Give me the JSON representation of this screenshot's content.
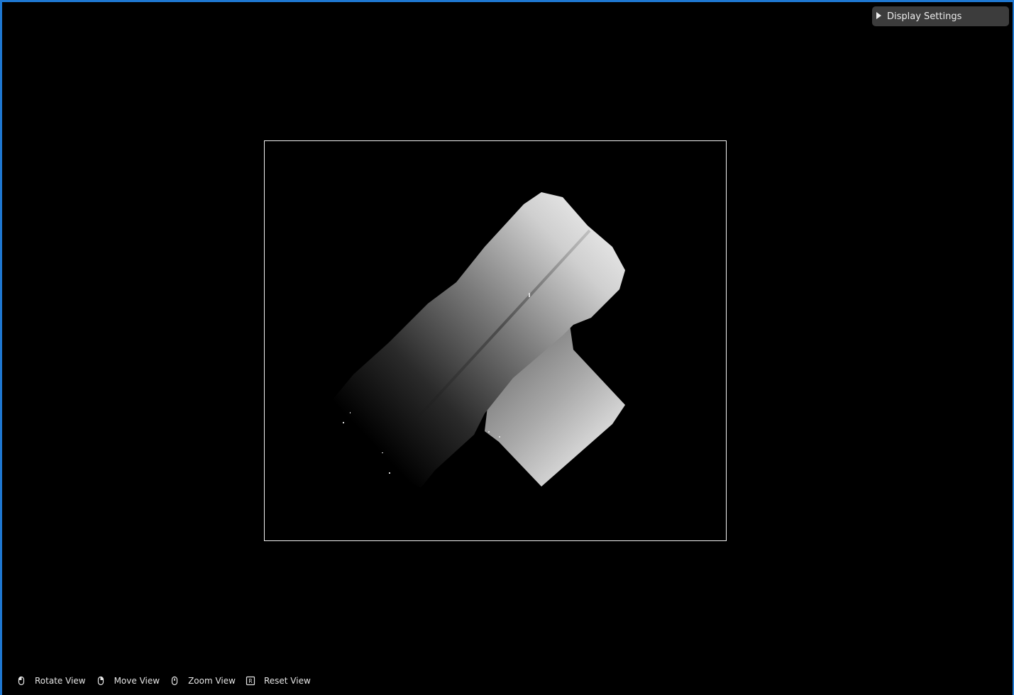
{
  "display_settings": {
    "label": "Display Settings",
    "icon": "triangle-right-icon",
    "expanded": false
  },
  "controls": [
    {
      "icon": "mouse-left-button-icon",
      "label": "Rotate View"
    },
    {
      "icon": "mouse-right-button-icon",
      "label": "Move View"
    },
    {
      "icon": "mouse-wheel-icon",
      "label": "Zoom View"
    },
    {
      "icon": "r-key-icon",
      "label": "Reset View"
    }
  ],
  "colors": {
    "window_border": "#1e78d2",
    "background": "#000000",
    "panel": "#3c3c3c",
    "frame": "#f2f2f2"
  }
}
